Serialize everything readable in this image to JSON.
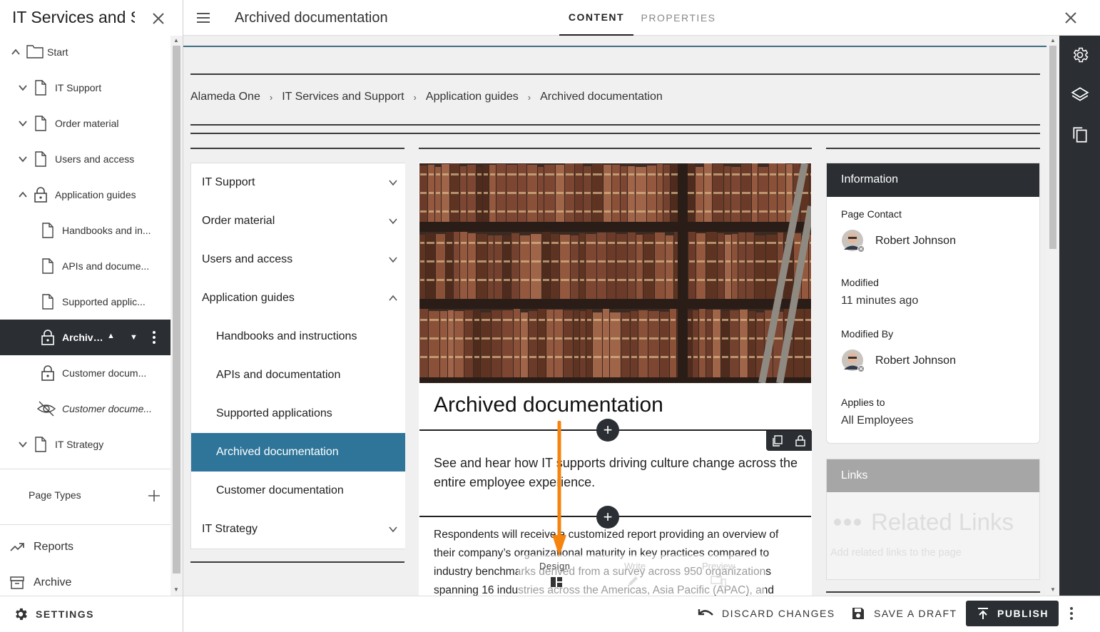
{
  "left_panel": {
    "title": "IT Services and Support",
    "tree": [
      {
        "label": "Start",
        "icon": "folder-icon",
        "toggle": "chevron-up-icon"
      },
      {
        "label": "IT Support",
        "icon": "page-icon",
        "toggle": "chevron-down-icon"
      },
      {
        "label": "Order material",
        "icon": "page-icon",
        "toggle": "chevron-down-icon"
      },
      {
        "label": "Users and access",
        "icon": "page-icon",
        "toggle": "chevron-down-icon"
      },
      {
        "label": "Application guides",
        "icon": "lock-icon",
        "toggle": "chevron-up-icon"
      },
      {
        "label": "Handbooks and in...",
        "icon": "page-icon"
      },
      {
        "label": "APIs and docume...",
        "icon": "page-icon"
      },
      {
        "label": "Supported applic...",
        "icon": "page-icon"
      },
      {
        "label": "Archive...",
        "icon": "lock-icon",
        "selected": true
      },
      {
        "label": "Customer docum...",
        "icon": "lock-icon"
      },
      {
        "label": "Customer docume...",
        "icon": "hidden-icon",
        "italic": true
      },
      {
        "label": "IT Strategy",
        "icon": "page-icon",
        "toggle": "chevron-down-icon"
      }
    ],
    "page_types_label": "Page Types",
    "reports_label": "Reports",
    "archive_label": "Archive",
    "settings_label": "SETTINGS"
  },
  "header": {
    "page_title": "Archived documentation",
    "tabs": [
      {
        "label": "CONTENT",
        "active": true
      },
      {
        "label": "PROPERTIES",
        "active": false
      }
    ]
  },
  "breadcrumb": [
    "Alameda One",
    "IT Services and Support",
    "Application guides",
    "Archived documentation"
  ],
  "side_nav": [
    {
      "label": "IT Support",
      "level": 0,
      "toggle": "chevron-down"
    },
    {
      "label": "Order material",
      "level": 0,
      "toggle": "chevron-down"
    },
    {
      "label": "Users and access",
      "level": 0,
      "toggle": "chevron-down"
    },
    {
      "label": "Application guides",
      "level": 0,
      "toggle": "chevron-up"
    },
    {
      "label": "Handbooks and instructions",
      "level": 1
    },
    {
      "label": "APIs and documentation",
      "level": 1
    },
    {
      "label": "Supported applications",
      "level": 1
    },
    {
      "label": "Archived documentation",
      "level": 1,
      "active": true
    },
    {
      "label": "Customer documentation",
      "level": 1
    },
    {
      "label": "IT Strategy",
      "level": 0,
      "toggle": "chevron-down"
    }
  ],
  "article": {
    "heading": "Archived documentation",
    "intro": "See and hear how IT supports driving culture change across the entire employee experience.",
    "body_lines": [
      "Respondents will receive a customized report providing an overview of",
      "their company’s organizational maturity in key practices compared to",
      "industry benchmarks derived from a survey across 950 organizations",
      "spanning 16 industries across the Americas, Asia Pacific (APAC), and"
    ],
    "toolbar": {
      "design_label": "Design",
      "write_label": "Write",
      "preview_label": "Preview"
    }
  },
  "info_panel": {
    "header": "Information",
    "page_contact_label": "Page Contact",
    "page_contact_name": "Robert Johnson",
    "modified_label": "Modified",
    "modified_value": "11 minutes ago",
    "modified_by_label": "Modified By",
    "modified_by_name": "Robert Johnson",
    "applies_to_label": "Applies to",
    "applies_to_value": "All Employees"
  },
  "links_panel": {
    "header": "Links",
    "placeholder_title": "Related Links",
    "placeholder_hint": "Add related links to the page"
  },
  "footer": {
    "discard_label": "DISCARD CHANGES",
    "save_draft_label": "SAVE A DRAFT",
    "publish_label": "PUBLISH"
  },
  "colors": {
    "dark": "#2b2f33",
    "accent": "#2e7599",
    "arrow": "#f7830f",
    "links_header": "#a6a6a6"
  }
}
